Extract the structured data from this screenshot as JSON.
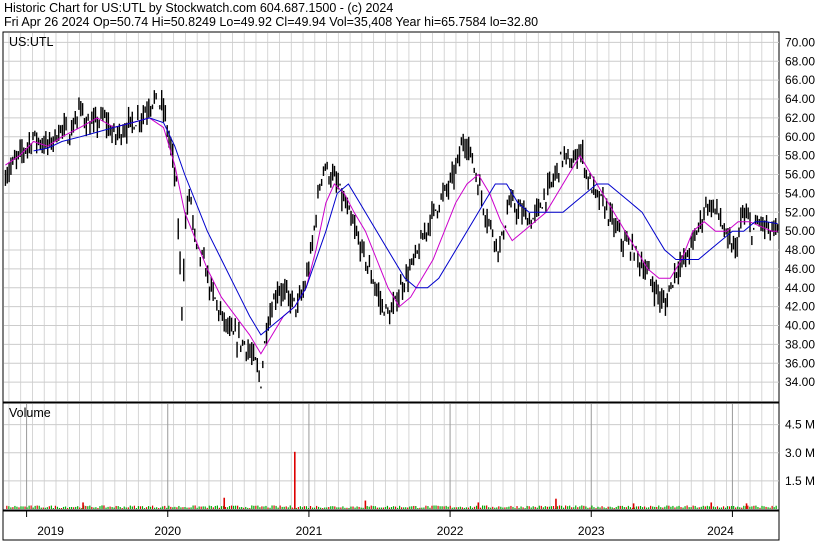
{
  "header": {
    "line1": "Historic Chart for US:UTL by Stockwatch.com 604.687.1500 - (c) 2024",
    "line2": "Fri Apr 26 2024   Op=50.74  Hi=50.8249   Lo=49.92   Cl=49.94  Vol=35,408   Year hi=65.7584  lo=32.80"
  },
  "colors": {
    "price": "#000000",
    "ma_short": "#cc00cc",
    "ma_long": "#0000cc",
    "vol_up": "#00aa00",
    "vol_down": "#dd0000",
    "grid": "#cccccc"
  },
  "chart_data": [
    {
      "type": "line",
      "title": "US:UTL",
      "ylim": [
        32,
        71
      ],
      "y_ticks": [
        "34.00",
        "36.00",
        "38.00",
        "40.00",
        "42.00",
        "44.00",
        "46.00",
        "48.00",
        "50.00",
        "52.00",
        "54.00",
        "56.00",
        "58.00",
        "60.00",
        "62.00",
        "64.00",
        "66.00",
        "68.00",
        "70.00"
      ],
      "x_ticks": [
        "2019",
        "2020",
        "2021",
        "2022",
        "2023",
        "2024"
      ],
      "xlim": [
        2018.84,
        2024.33
      ],
      "grid": true,
      "series": [
        {
          "role": "price",
          "x": [
            2018.85,
            2018.95,
            2019.05,
            2019.15,
            2019.25,
            2019.3,
            2019.38,
            2019.45,
            2019.55,
            2019.62,
            2019.7,
            2019.8,
            2019.9,
            2019.97,
            2020.02,
            2020.06,
            2020.1,
            2020.13,
            2020.16,
            2020.2,
            2020.25,
            2020.3,
            2020.38,
            2020.45,
            2020.55,
            2020.62,
            2020.66,
            2020.7,
            2020.78,
            2020.85,
            2020.92,
            2020.97,
            2021.02,
            2021.06,
            2021.1,
            2021.15,
            2021.2,
            2021.25,
            2021.3,
            2021.35,
            2021.4,
            2021.45,
            2021.52,
            2021.58,
            2021.65,
            2021.72,
            2021.78,
            2021.85,
            2021.92,
            2022.0,
            2022.05,
            2022.1,
            2022.15,
            2022.2,
            2022.25,
            2022.3,
            2022.35,
            2022.42,
            2022.5,
            2022.58,
            2022.65,
            2022.72,
            2022.8,
            2022.87,
            2022.92,
            2022.97,
            2023.02,
            2023.08,
            2023.15,
            2023.22,
            2023.3,
            2023.38,
            2023.45,
            2023.52,
            2023.6,
            2023.67,
            2023.75,
            2023.82,
            2023.9,
            2023.96,
            2024.02,
            2024.08,
            2024.14,
            2024.2,
            2024.26,
            2024.32
          ],
          "y": [
            56,
            58,
            60,
            59,
            61,
            60,
            63,
            61,
            62,
            60,
            61,
            62,
            64,
            63,
            59,
            55,
            42,
            52,
            54,
            48,
            47,
            44,
            41,
            39,
            38,
            36,
            34,
            40,
            44,
            43,
            42,
            44,
            48,
            53,
            57,
            56,
            55,
            53,
            51,
            49,
            47,
            45,
            42,
            41,
            44,
            46,
            48,
            51,
            53,
            55,
            57,
            60,
            58,
            55,
            52,
            50,
            48,
            53,
            52,
            51,
            53,
            55,
            58,
            57,
            59,
            56,
            54,
            53,
            51,
            49,
            48,
            46,
            44,
            42,
            46,
            47,
            50,
            53,
            52,
            49,
            48,
            52,
            50,
            51,
            50,
            49.94
          ]
        },
        {
          "role": "ma_short",
          "x": [
            2018.85,
            2018.95,
            2019.05,
            2019.15,
            2019.25,
            2019.38,
            2019.5,
            2019.62,
            2019.75,
            2019.87,
            2019.97,
            2020.05,
            2020.12,
            2020.2,
            2020.28,
            2020.38,
            2020.48,
            2020.58,
            2020.66,
            2020.74,
            2020.82,
            2020.9,
            2020.98,
            2021.05,
            2021.12,
            2021.18,
            2021.25,
            2021.32,
            2021.4,
            2021.48,
            2021.56,
            2021.64,
            2021.72,
            2021.8,
            2021.88,
            2021.96,
            2022.04,
            2022.12,
            2022.2,
            2022.28,
            2022.36,
            2022.44,
            2022.52,
            2022.6,
            2022.68,
            2022.76,
            2022.84,
            2022.92,
            2023.0,
            2023.08,
            2023.16,
            2023.24,
            2023.32,
            2023.4,
            2023.48,
            2023.56,
            2023.64,
            2023.72,
            2023.8,
            2023.88,
            2023.96,
            2024.04,
            2024.12,
            2024.2,
            2024.28,
            2024.32
          ],
          "y": [
            57,
            58,
            59.5,
            59,
            60,
            61,
            62,
            61,
            61.5,
            62,
            61,
            57,
            52,
            49,
            46,
            43,
            41,
            39,
            37,
            39,
            41,
            42,
            44,
            48,
            53,
            55,
            54,
            52,
            50,
            47,
            44,
            42,
            43,
            45,
            47,
            50,
            53,
            55,
            56,
            54,
            51,
            49,
            50,
            51,
            52,
            54,
            56,
            58,
            56,
            54,
            52,
            50,
            48,
            46,
            45,
            45,
            47,
            50,
            51,
            50,
            50,
            51,
            51,
            50.5,
            50,
            50
          ]
        },
        {
          "role": "ma_long",
          "x": [
            2019.05,
            2019.15,
            2019.25,
            2019.38,
            2019.5,
            2019.62,
            2019.75,
            2019.87,
            2019.97,
            2020.05,
            2020.12,
            2020.2,
            2020.28,
            2020.38,
            2020.48,
            2020.58,
            2020.66,
            2020.74,
            2020.82,
            2020.9,
            2020.98,
            2021.05,
            2021.12,
            2021.2,
            2021.28,
            2021.36,
            2021.44,
            2021.52,
            2021.6,
            2021.68,
            2021.76,
            2021.84,
            2021.92,
            2022.0,
            2022.08,
            2022.16,
            2022.24,
            2022.32,
            2022.4,
            2022.48,
            2022.56,
            2022.64,
            2022.72,
            2022.8,
            2022.88,
            2022.96,
            2023.04,
            2023.12,
            2023.2,
            2023.28,
            2023.36,
            2023.44,
            2023.52,
            2023.6,
            2023.68,
            2023.76,
            2023.84,
            2023.92,
            2024.0,
            2024.08,
            2024.16,
            2024.24,
            2024.32
          ],
          "y": [
            58.5,
            58.8,
            59.5,
            60,
            60.5,
            61,
            61.5,
            62,
            61.5,
            59,
            56,
            53,
            50,
            47,
            44,
            41,
            39,
            40,
            41,
            42,
            44,
            47,
            50,
            54,
            55,
            53,
            51,
            49,
            47,
            45,
            44,
            44,
            45,
            47,
            49,
            51,
            53,
            55,
            55,
            53,
            52,
            52,
            52,
            52,
            53,
            54,
            55,
            55,
            54,
            53,
            52,
            50,
            48,
            47,
            47,
            47,
            48,
            49,
            50,
            50,
            51,
            51,
            50.8
          ]
        }
      ]
    },
    {
      "type": "bar",
      "title": "Volume",
      "ylim": [
        0,
        5.6
      ],
      "y_ticks": [
        "1.5 M",
        "3.0 M",
        "4.5 M"
      ],
      "x": [
        2019.4,
        2020.4,
        2020.9,
        2021.4,
        2022.2,
        2022.75,
        2023.3,
        2023.85,
        2024.1
      ],
      "values": [
        0.35,
        0.6,
        3.05,
        0.45,
        0.35,
        0.55,
        0.3,
        0.35,
        0.3
      ],
      "baseline_volume": 0.12
    }
  ]
}
